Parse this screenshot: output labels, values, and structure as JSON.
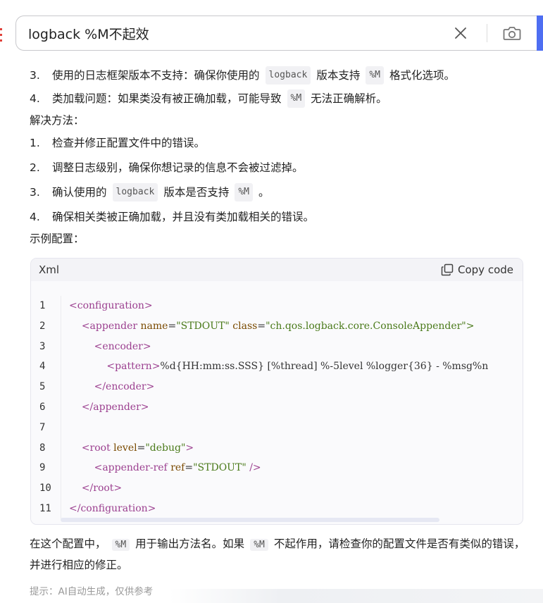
{
  "search": {
    "query": "logback %M不起效"
  },
  "causes": [
    {
      "num": "3.",
      "pre": "使用的日志框架版本不支持：确保你使用的",
      "code": "logback",
      "mid": "版本支持",
      "code2": "%M",
      "post": "格式化选项。"
    },
    {
      "num": "4.",
      "pre": "类加载问题：如果类没有被正确加载，可能导致",
      "code": "%M",
      "post": "无法正确解析。"
    }
  ],
  "solutions_title": "解决方法：",
  "solutions": [
    {
      "num": "1.",
      "text": "检查并修正配置文件中的错误。"
    },
    {
      "num": "2.",
      "text": "调整日志级别，确保你想记录的信息不会被过滤掉。"
    },
    {
      "num": "3.",
      "pre": "确认使用的",
      "code": "logback",
      "mid": "版本是否支持",
      "code2": "%M",
      "post": "。"
    },
    {
      "num": "4.",
      "text": "确保相关类被正确加载，并且没有类加载相关的错误。"
    }
  ],
  "example_title": "示例配置：",
  "code_block": {
    "language": "Xml",
    "copy_label": "Copy code",
    "line_numbers": [
      "1",
      "2",
      "3",
      "4",
      "5",
      "6",
      "7",
      "8",
      "9",
      "10",
      "11"
    ],
    "lines": [
      [
        {
          "t": "tag",
          "v": "<configuration>"
        }
      ],
      [
        {
          "t": "text",
          "v": "    "
        },
        {
          "t": "tag",
          "v": "<appender "
        },
        {
          "t": "attr",
          "v": "name"
        },
        {
          "t": "text",
          "v": "="
        },
        {
          "t": "str",
          "v": "\"STDOUT\""
        },
        {
          "t": "text",
          "v": " "
        },
        {
          "t": "attr",
          "v": "class"
        },
        {
          "t": "text",
          "v": "="
        },
        {
          "t": "str",
          "v": "\"ch.qos.logback.core.ConsoleAppender\">"
        }
      ],
      [
        {
          "t": "text",
          "v": "        "
        },
        {
          "t": "tag",
          "v": "<encoder>"
        }
      ],
      [
        {
          "t": "text",
          "v": "            "
        },
        {
          "t": "tag",
          "v": "<pattern>"
        },
        {
          "t": "text",
          "v": "%d{HH:mm:ss.SSS} [%thread] %-5level %logger{36} - %msg%n"
        }
      ],
      [
        {
          "t": "text",
          "v": "        "
        },
        {
          "t": "tag",
          "v": "</encoder>"
        }
      ],
      [
        {
          "t": "text",
          "v": "    "
        },
        {
          "t": "tag",
          "v": "</appender>"
        }
      ],
      [
        {
          "t": "text",
          "v": ""
        }
      ],
      [
        {
          "t": "text",
          "v": "    "
        },
        {
          "t": "tag",
          "v": "<root "
        },
        {
          "t": "attr",
          "v": "level"
        },
        {
          "t": "text",
          "v": "="
        },
        {
          "t": "str",
          "v": "\"debug\""
        },
        {
          "t": "tag",
          "v": ">"
        }
      ],
      [
        {
          "t": "text",
          "v": "        "
        },
        {
          "t": "tag",
          "v": "<appender-ref "
        },
        {
          "t": "attr",
          "v": "ref"
        },
        {
          "t": "text",
          "v": "="
        },
        {
          "t": "str",
          "v": "\"STDOUT\""
        },
        {
          "t": "tag",
          "v": " />"
        }
      ],
      [
        {
          "t": "text",
          "v": "    "
        },
        {
          "t": "tag",
          "v": "</root>"
        }
      ],
      [
        {
          "t": "tag",
          "v": "</configuration>"
        }
      ]
    ]
  },
  "summary": {
    "pre": "在这个配置中，",
    "code": "%M",
    "mid": "用于输出方法名。如果",
    "code2": "%M",
    "post": "不起作用，请检查你的配置文件是否有类似的错误，并进行相应的修正。"
  },
  "hint": "提示：AI自动生成，仅供参考",
  "colors": {
    "accent": "#4e6ef2",
    "tag": "#9b3f8f",
    "attr": "#7a4a00",
    "string": "#4a7a1a"
  }
}
